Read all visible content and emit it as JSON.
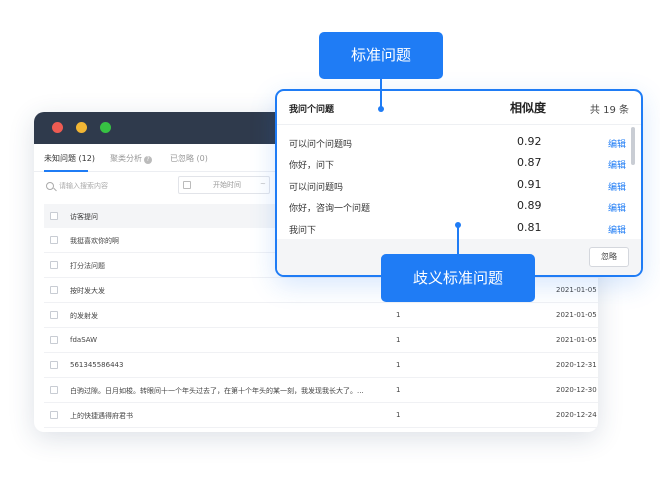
{
  "back_window": {
    "tabs": [
      {
        "label": "未知问题 (12)"
      },
      {
        "label": "聚类分析"
      },
      {
        "label": "已忽略 (0)"
      }
    ],
    "search_placeholder": "请输入搜索内容",
    "date_placeholder": "开始时间",
    "table_header": {
      "question": "访客提问"
    },
    "rows": [
      {
        "question": "我挺喜欢你的啊",
        "count": "",
        "date": ""
      },
      {
        "question": "打分法问题",
        "count": "",
        "date": ""
      },
      {
        "question": "按时发大发",
        "count": "",
        "date": "2021-01-05"
      },
      {
        "question": "的发射发",
        "count": "1",
        "date": "2021-01-05"
      },
      {
        "question": "fdaSAW",
        "count": "1",
        "date": "2021-01-05"
      },
      {
        "question": "561345586443",
        "count": "1",
        "date": "2020-12-31"
      },
      {
        "question": "白驹过隙。日月如梭。转眼间十一个年头过去了，在第十个年头的某一刻，我发现我长大了。...",
        "count": "1",
        "date": "2020-12-30"
      },
      {
        "question": "上的快捷遇得府君书",
        "count": "1",
        "date": "2020-12-24"
      }
    ]
  },
  "popup": {
    "my_question_label": "我问个问题",
    "similarity_label": "相似度",
    "total_label": "共 19 条",
    "rows": [
      {
        "question": "可以问个问题吗",
        "score": "0.92",
        "action": "编辑"
      },
      {
        "question": "你好，问下",
        "score": "0.87",
        "action": "编辑"
      },
      {
        "question": "可以问问题吗",
        "score": "0.91",
        "action": "编辑"
      },
      {
        "question": "你好，咨询一个问题",
        "score": "0.89",
        "action": "编辑"
      },
      {
        "question": "我问下",
        "score": "0.81",
        "action": "编辑"
      }
    ],
    "ignore_label": "忽略"
  },
  "callouts": {
    "top": "标准问题",
    "bottom": "歧义标准问题"
  },
  "colors": {
    "accent": "#1f7cf5",
    "titlebar": "#2f3a4c",
    "dot_red": "#ee5b52",
    "dot_yellow": "#f2b634",
    "dot_green": "#37c243"
  }
}
